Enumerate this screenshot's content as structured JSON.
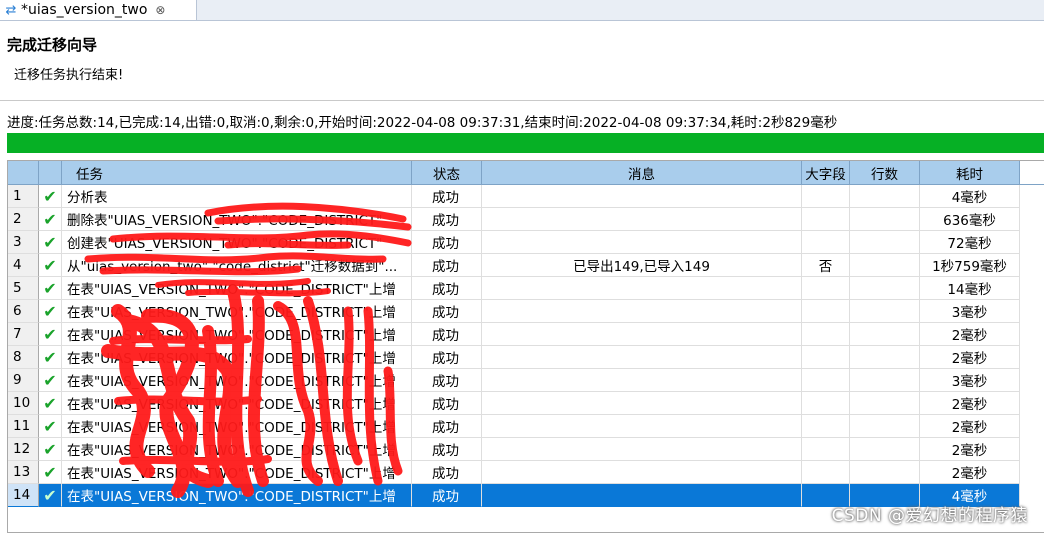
{
  "tab": {
    "title": "*uias_version_two",
    "icon": "swap-arrows-icon",
    "close": "⊗"
  },
  "wizard": {
    "title": "完成迁移向导",
    "subtitle": "迁移任务执行结束!"
  },
  "progress": {
    "text": "进度:任务总数:14,已完成:14,出错:0,取消:0,剩余:0,开始时间:2022-04-08 09:37:31,结束时间:2022-04-08 09:37:34,耗时:2秒829毫秒",
    "percent": 100,
    "color": "#06b025"
  },
  "table": {
    "columns": [
      "任务",
      "状态",
      "消息",
      "大字段",
      "行数",
      "耗时"
    ],
    "rows": [
      {
        "num": "1",
        "task": "分析表",
        "status": "成功",
        "message": "",
        "big_field": "",
        "rows": "",
        "time": "4毫秒"
      },
      {
        "num": "2",
        "task": "删除表\"UIAS_VERSION_TWO\".\"CODE_DISTRICT\"",
        "status": "成功",
        "message": "",
        "big_field": "",
        "rows": "",
        "time": "636毫秒"
      },
      {
        "num": "3",
        "task": "创建表\"UIAS_VERSION_TWO\".\"CODE_DISTRICT\"",
        "status": "成功",
        "message": "",
        "big_field": "",
        "rows": "",
        "time": "72毫秒"
      },
      {
        "num": "4",
        "task": "从\"uias_version_two\".\"code_district\"迁移数据到\"...",
        "status": "成功",
        "message": "已导出149,已导入149",
        "big_field": "否",
        "rows": "",
        "time": "1秒759毫秒"
      },
      {
        "num": "5",
        "task": "在表\"UIAS_VERSION_TWO\".\"CODE_DISTRICT\"上增",
        "status": "成功",
        "message": "",
        "big_field": "",
        "rows": "",
        "time": "14毫秒"
      },
      {
        "num": "6",
        "task": "在表\"UIAS_VERSION_TWO\".\"CODE_DISTRICT\"上增",
        "status": "成功",
        "message": "",
        "big_field": "",
        "rows": "",
        "time": "3毫秒"
      },
      {
        "num": "7",
        "task": "在表\"UIAS_VERSION_TWO\".\"CODE_DISTRICT\"上增",
        "status": "成功",
        "message": "",
        "big_field": "",
        "rows": "",
        "time": "2毫秒"
      },
      {
        "num": "8",
        "task": "在表\"UIAS_VERSION_TWO\".\"CODE_DISTRICT\"上增",
        "status": "成功",
        "message": "",
        "big_field": "",
        "rows": "",
        "time": "2毫秒"
      },
      {
        "num": "9",
        "task": "在表\"UIAS_VERSION_TWO\".\"CODE_DISTRICT\"上增",
        "status": "成功",
        "message": "",
        "big_field": "",
        "rows": "",
        "time": "3毫秒"
      },
      {
        "num": "10",
        "task": "在表\"UIAS_VERSION_TWO\".\"CODE_DISTRICT\"上增",
        "status": "成功",
        "message": "",
        "big_field": "",
        "rows": "",
        "time": "2毫秒"
      },
      {
        "num": "11",
        "task": "在表\"UIAS_VERSION_TWO\".\"CODE_DISTRICT\"上增",
        "status": "成功",
        "message": "",
        "big_field": "",
        "rows": "",
        "time": "2毫秒"
      },
      {
        "num": "12",
        "task": "在表\"UIAS_VERSION_TWO\".\"CODE_DISTRICT\"上增",
        "status": "成功",
        "message": "",
        "big_field": "",
        "rows": "",
        "time": "2毫秒"
      },
      {
        "num": "13",
        "task": "在表\"UIAS_VERSION_TWO\".\"CODE_DISTRICT\"上增",
        "status": "成功",
        "message": "",
        "big_field": "",
        "rows": "",
        "time": "2毫秒"
      },
      {
        "num": "14",
        "task": "在表\"UIAS_VERSION_TWO\".\"CODE_DISTRICT\"上增",
        "status": "成功",
        "message": "",
        "big_field": "",
        "rows": "",
        "time": "4毫秒"
      }
    ]
  },
  "selected_row": 14,
  "watermark": "CSDN @爱幻想的程序猿",
  "colors": {
    "header": "#a9cdec",
    "selection": "#0a78d7",
    "check": "#1aa32b",
    "redaction": "#ff1a1a"
  }
}
